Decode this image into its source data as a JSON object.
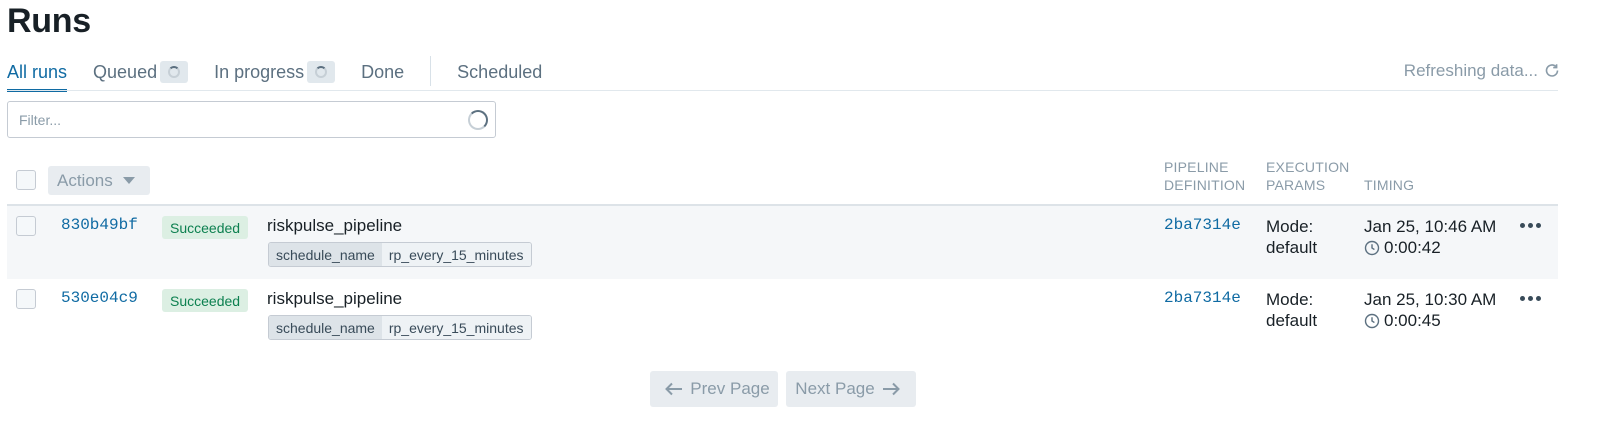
{
  "page": {
    "title": "Runs"
  },
  "tabs": [
    {
      "label": "All runs",
      "active": true
    },
    {
      "label": "Queued",
      "loading": true
    },
    {
      "label": "In progress",
      "loading": true
    },
    {
      "label": "Done"
    },
    {
      "label": "Scheduled"
    }
  ],
  "refresh": {
    "label": "Refreshing data...",
    "icon": "refresh-icon"
  },
  "filter": {
    "placeholder": "Filter...",
    "value": "",
    "icon": "spinner-icon"
  },
  "toolbar": {
    "actions_label": "Actions"
  },
  "columns": {
    "pipeline_definition": [
      "PIPELINE",
      "DEFINITION"
    ],
    "execution_params": [
      "EXECUTION",
      "PARAMS"
    ],
    "timing": "TIMING"
  },
  "runs": [
    {
      "id": "830b49bf",
      "status": "Succeeded",
      "pipeline": "riskpulse_pipeline",
      "tag_key": "schedule_name",
      "tag_value": "rp_every_15_minutes",
      "snapshot": "2ba7314e",
      "mode_label": "Mode:",
      "mode_value": "default",
      "start": "Jan 25, 10:46 AM",
      "duration": "0:00:42"
    },
    {
      "id": "530e04c9",
      "status": "Succeeded",
      "pipeline": "riskpulse_pipeline",
      "tag_key": "schedule_name",
      "tag_value": "rp_every_15_minutes",
      "snapshot": "2ba7314e",
      "mode_label": "Mode:",
      "mode_value": "default",
      "start": "Jan 25, 10:30 AM",
      "duration": "0:00:45"
    }
  ],
  "pagination": {
    "prev_label": "Prev Page",
    "next_label": "Next Page"
  },
  "colors": {
    "accent": "#106ba3",
    "success_bg": "#dcefe3",
    "success_text": "#0d8050",
    "muted": "#8a9ba8"
  }
}
